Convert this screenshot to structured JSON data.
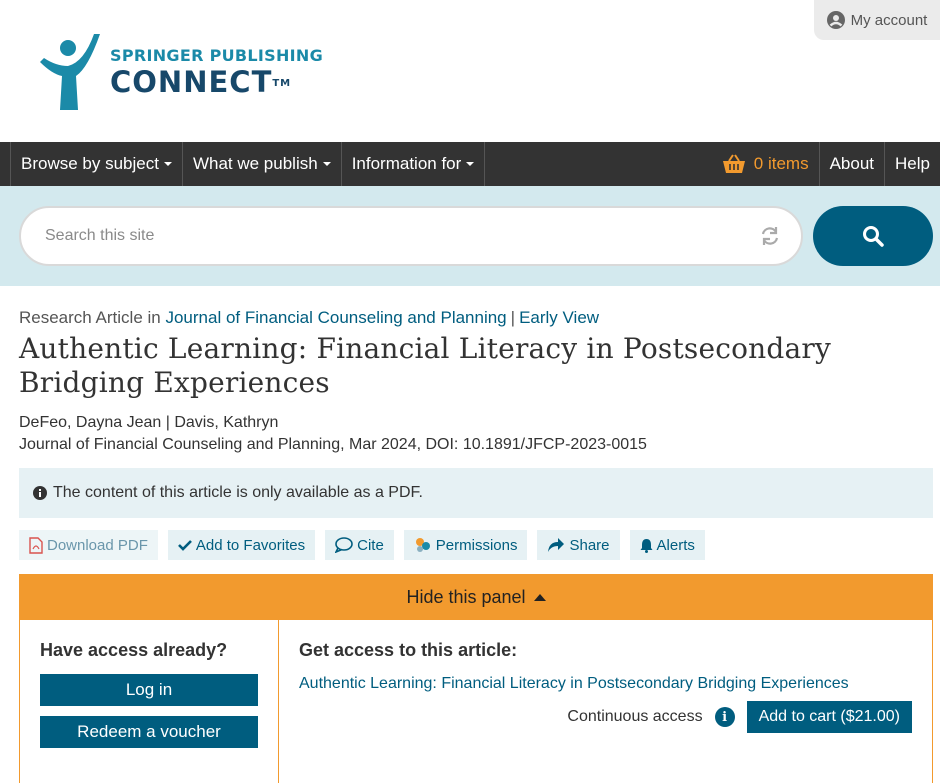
{
  "brand": {
    "top": "SPRINGER PUBLISHING",
    "main": "CONNECT",
    "tm": "TM",
    "color_primary": "#005d7f",
    "color_accent": "#f29a2e"
  },
  "account": {
    "label": "My account",
    "icon": "user-circle-icon"
  },
  "nav": {
    "items": [
      {
        "label": "Browse by subject"
      },
      {
        "label": "What we publish"
      },
      {
        "label": "Information for"
      }
    ],
    "cart_label": "0 items",
    "about": "About",
    "help": "Help"
  },
  "search": {
    "placeholder": "Search this site",
    "value": ""
  },
  "article": {
    "type_prefix": "Research Article in",
    "journal": "Journal of Financial Counseling and Planning",
    "early_view": "Early View",
    "title": "Authentic Learning: Financial Literacy in Postsecondary Bridging Experiences",
    "authors": "DeFeo, Dayna Jean | Davis, Kathryn",
    "citation": "Journal of Financial Counseling and Planning, Mar 2024, DOI: 10.1891/JFCP-2023-0015"
  },
  "notice": "The content of this article is only available as a PDF.",
  "actions": {
    "download_pdf": "Download PDF",
    "favorites": "Add to Favorites",
    "cite": "Cite",
    "permissions": "Permissions",
    "share": "Share",
    "alerts": "Alerts"
  },
  "panel": {
    "toggle_label": "Hide this panel",
    "left_heading": "Have access already?",
    "login": "Log in",
    "voucher": "Redeem a voucher",
    "right_heading": "Get access to this article:",
    "article_link": "Authentic Learning: Financial Literacy in Postsecondary Bridging Experiences",
    "access_label": "Continuous access",
    "cart_button": "Add to cart ($21.00)"
  }
}
